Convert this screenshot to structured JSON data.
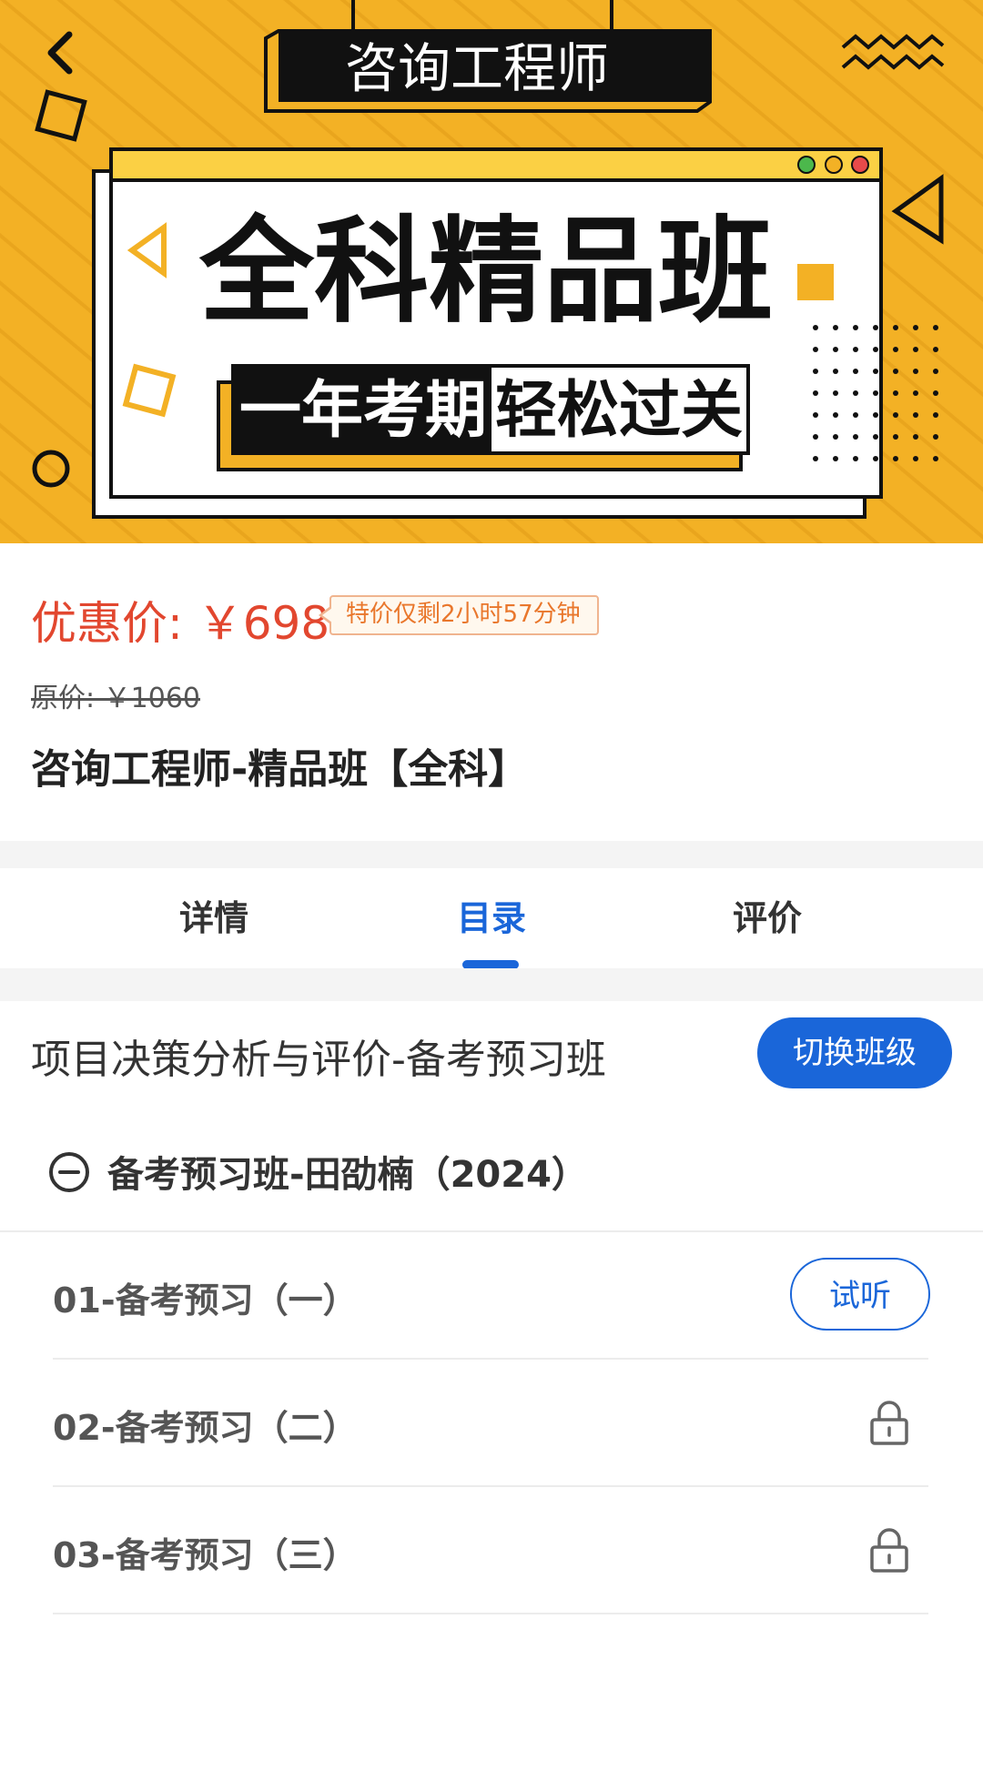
{
  "banner": {
    "top_label": "咨询工程师",
    "headline": "全科精品班",
    "sub_left": "一年考期",
    "sub_right": "轻松过关",
    "colors": {
      "background": "#f3b125",
      "panel_header": "#fbd044",
      "dark": "#111111"
    }
  },
  "price": {
    "promo": "优惠价: ￥698",
    "countdown": "特价仅剩2小时57分钟",
    "original": "原价: ￥1060"
  },
  "course": {
    "title": "咨询工程师-精品班【全科】"
  },
  "tabs": [
    {
      "label": "详情",
      "active": false
    },
    {
      "label": "目录",
      "active": true
    },
    {
      "label": "评价",
      "active": false
    }
  ],
  "catalog": {
    "class_name": "项目决策分析与评价-备考预习班",
    "switch_label": "切换班级",
    "group_title": "备考预习班-田劭楠（2024）",
    "lessons": [
      {
        "title": "01-备考预习（一）",
        "action": "试听",
        "locked": false
      },
      {
        "title": "02-备考预习（二）",
        "locked": true
      },
      {
        "title": "03-备考预习（三）",
        "locked": true
      }
    ]
  },
  "colors": {
    "accent": "#1a66d9",
    "price_red": "#e2472f",
    "countdown_orange": "#e9772c"
  }
}
